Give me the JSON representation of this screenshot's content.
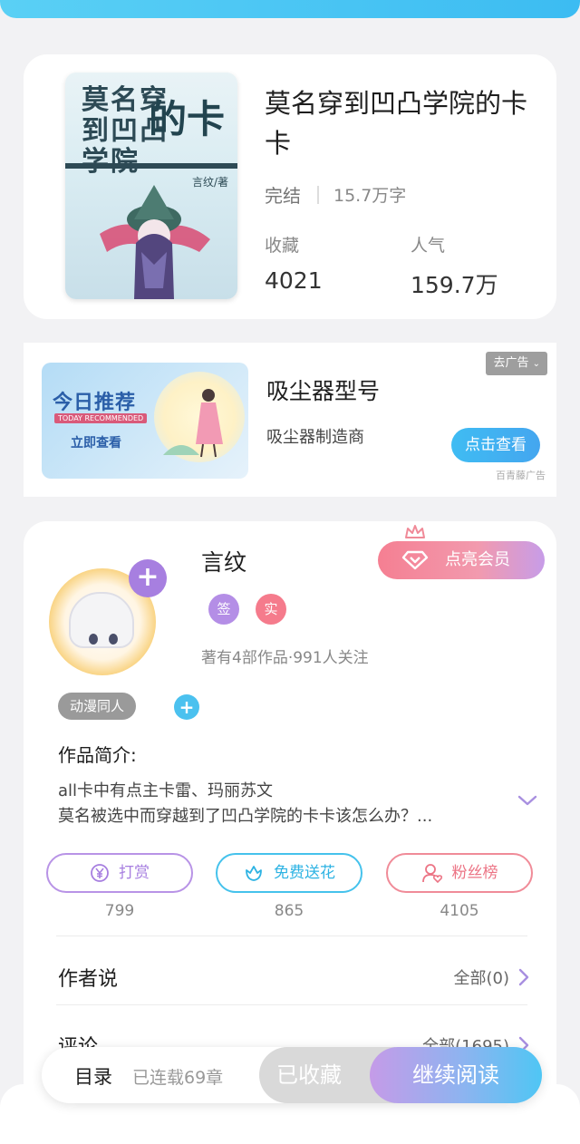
{
  "book": {
    "cover_title_a": "莫名穿到凹凸学院",
    "cover_title_b": "的卡",
    "cover_author": "言纹/著",
    "title": "莫名穿到凹凸学院的卡卡",
    "status": "完结",
    "word_count": "15.7万字",
    "favorites_label": "收藏",
    "favorites_value": "4021",
    "popularity_label": "人气",
    "popularity_value": "159.7万"
  },
  "ad": {
    "banner_title": "今日推荐",
    "banner_sub": "TODAY RECOMMENDED",
    "banner_button": "立即查看",
    "title": "吸尘器型号",
    "subtitle": "吸尘器制造商",
    "close_label": "去广告",
    "cta_label": "点击查看",
    "source": "百青藤广告"
  },
  "author": {
    "name": "言纹",
    "badge_sign": "签",
    "badge_real": "实",
    "stats": "著有4部作品·991人关注",
    "vip_label": "点亮会员",
    "tag": "动漫同人",
    "intro_label": "作品简介:",
    "intro_line1": "all卡中有点主卡雷、玛丽苏文",
    "intro_line2": "莫名被选中而穿越到了凹凸学院的卡卡该怎么办？...",
    "actions": [
      {
        "label": "打赏",
        "count": "799"
      },
      {
        "label": "免费送花",
        "count": "865"
      },
      {
        "label": "粉丝榜",
        "count": "4105"
      }
    ],
    "author_says_label": "作者说",
    "author_says_right": "全部(0)",
    "comments_label": "评论",
    "comments_right": "全部(1695)"
  },
  "bottom_bar": {
    "toc_label": "目录",
    "chapters": "已连载69章",
    "collected_label": "已收藏",
    "read_label": "继续阅读"
  },
  "colors": {
    "accent_blue": "#3cbcf2",
    "accent_purple": "#a77fe0",
    "accent_pink": "#f57f92"
  }
}
